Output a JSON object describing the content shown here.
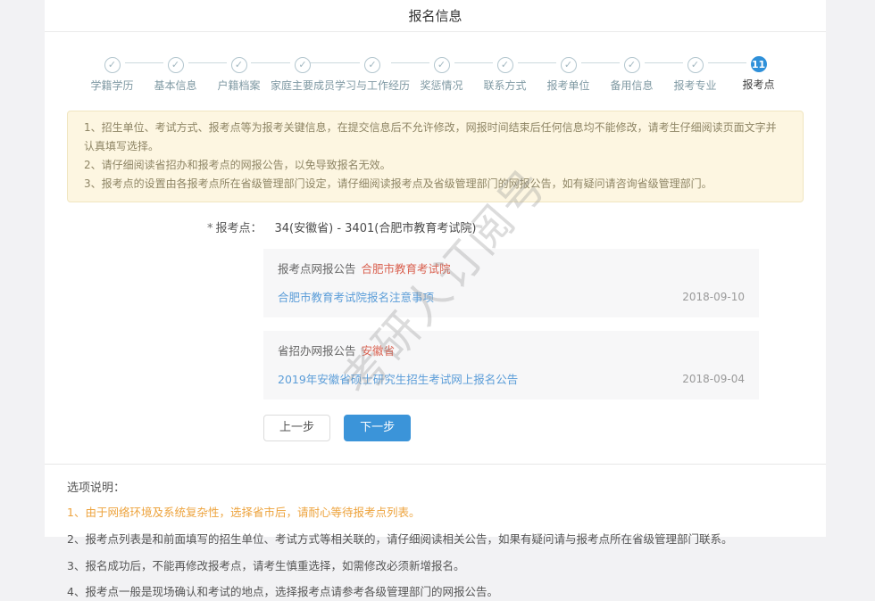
{
  "page": {
    "title": "报名信息"
  },
  "stepper": {
    "check_glyph": "✓",
    "steps": [
      {
        "label": "学籍学历",
        "state": "done"
      },
      {
        "label": "基本信息",
        "state": "done"
      },
      {
        "label": "户籍档案",
        "state": "done"
      },
      {
        "label": "家庭主要成员",
        "state": "done"
      },
      {
        "label": "学习与工作经历",
        "state": "done"
      },
      {
        "label": "奖惩情况",
        "state": "done"
      },
      {
        "label": "联系方式",
        "state": "done"
      },
      {
        "label": "报考单位",
        "state": "done"
      },
      {
        "label": "备用信息",
        "state": "done"
      },
      {
        "label": "报考专业",
        "state": "done"
      },
      {
        "label": "报考点",
        "state": "current",
        "number": "11"
      }
    ]
  },
  "notice": {
    "items": [
      "1、招生单位、考试方式、报考点等为报考关键信息，在提交信息后不允许修改，网报时间结束后任何信息均不能修改，请考生仔细阅读页面文字并认真填写选择。",
      "2、请仔细阅读省招办和报考点的网报公告，以免导致报名无效。",
      "3、报考点的设置由各报考点所在省级管理部门设定，请仔细阅读报考点及省级管理部门的网报公告，如有疑问请咨询省级管理部门。"
    ]
  },
  "form": {
    "required_mark": "*",
    "label": "报考点：",
    "value": "34(安徽省) - 3401(合肥市教育考试院)"
  },
  "announcements": [
    {
      "type_label": "报考点网报公告",
      "org": "合肥市教育考试院",
      "link": "合肥市教育考试院报名注意事项",
      "date": "2018-09-10"
    },
    {
      "type_label": "省招办网报公告",
      "org": "安徽省",
      "link": "2019年安徽省硕士研究生招生考试网上报名公告",
      "date": "2018-09-04"
    }
  ],
  "buttons": {
    "prev": "上一步",
    "next": "下一步"
  },
  "options_note": {
    "heading": "选项说明：",
    "items": [
      {
        "text": "1、由于网络环境及系统复杂性，选择省市后，请耐心等待报考点列表。",
        "highlight": true
      },
      {
        "text": "2、报考点列表是和前面填写的招生单位、考试方式等相关联的，请仔细阅读相关公告，如果有疑问请与报考点所在省级管理部门联系。",
        "highlight": false
      },
      {
        "text": "3、报名成功后，不能再修改报考点，请考生慎重选择，如需修改必须新增报名。",
        "highlight": false
      },
      {
        "text": "4、报考点一般是现场确认和考试的地点，选择报考点请参考各级管理部门的网报公告。",
        "highlight": false
      }
    ]
  },
  "watermark": "考研人订阅号",
  "colors": {
    "accent_blue": "#2f90d9",
    "link_blue": "#5b9dd8",
    "alert_red": "#d9604f",
    "highlight_orange": "#eda33d",
    "notice_bg": "#fdf6e1",
    "notice_border": "#f0e5c0",
    "page_bg": "#f2f2f4"
  }
}
